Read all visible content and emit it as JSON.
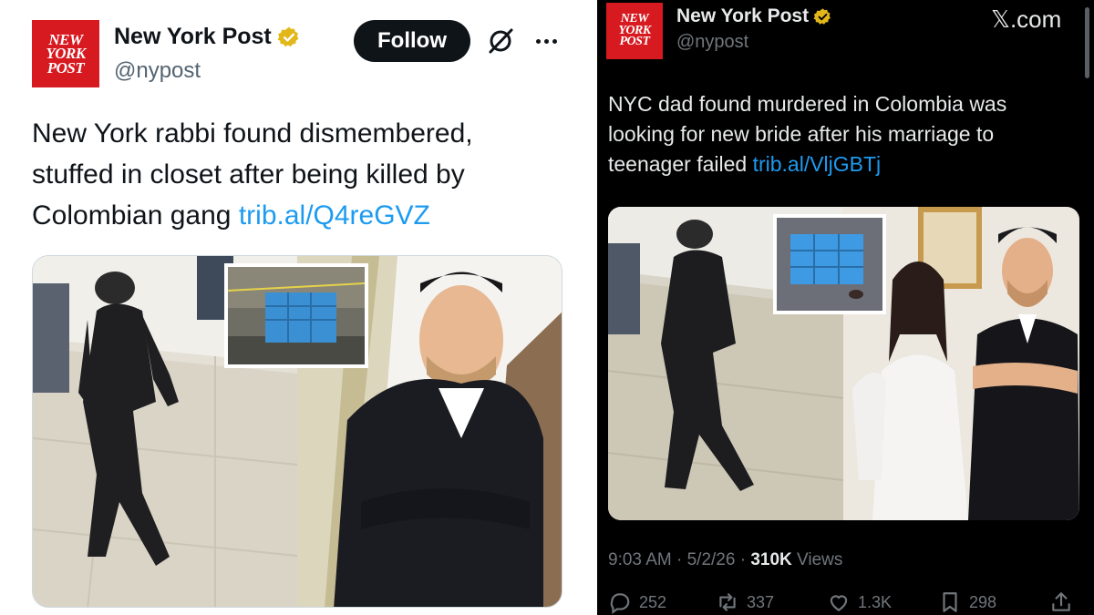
{
  "left_tweet": {
    "logo_lines": [
      "NEW",
      "YORK",
      "POST"
    ],
    "author_name": "New York Post",
    "handle": "@nypost",
    "follow_label": "Follow",
    "text": "New York rabbi found dismembered, stuffed in closet after being killed by Colombian gang ",
    "link": "trib.al/Q4reGVZ",
    "icons": [
      "verified-badge-icon",
      "grok-icon",
      "more-icon"
    ]
  },
  "right_tweet": {
    "logo_lines": [
      "NEW",
      "YORK",
      "POST"
    ],
    "author_name": "New York Post",
    "handle": "@nypost",
    "watermark": "𝕏.com",
    "text": "NYC dad found murdered in Colombia was looking for new bride after his marriage to teenager failed ",
    "link": "trib.al/VljGBTj",
    "time": "9:03 AM",
    "date": "5/2/26",
    "views_count": "310K",
    "views_label": "Views",
    "replies": "252",
    "reposts": "337",
    "likes": "1.3K",
    "bookmarks": "298",
    "icons": [
      "reply-icon",
      "repost-icon",
      "like-icon",
      "bookmark-icon",
      "share-icon"
    ]
  },
  "colors": {
    "brand_red": "#d71920",
    "verified_gold": "#e2b719",
    "link_blue": "#1d9bf0",
    "dark_bg": "#000000",
    "light_bg": "#ffffff"
  }
}
